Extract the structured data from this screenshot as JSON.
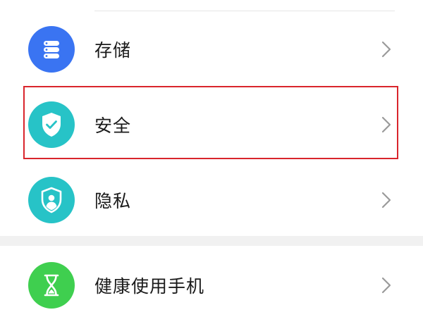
{
  "settings": {
    "items": [
      {
        "key": "storage",
        "label": "存储",
        "icon": "storage-icon",
        "icon_color": "#3a74f2"
      },
      {
        "key": "security",
        "label": "安全",
        "icon": "shield-check-icon",
        "icon_color": "#27c3c7"
      },
      {
        "key": "privacy",
        "label": "隐私",
        "icon": "privacy-shield-icon",
        "icon_color": "#27c3c7"
      },
      {
        "key": "health",
        "label": "健康使用手机",
        "icon": "hourglass-icon",
        "icon_color": "#3fcf4f"
      }
    ],
    "highlighted_item": "security",
    "highlight_color": "#d9252c"
  }
}
